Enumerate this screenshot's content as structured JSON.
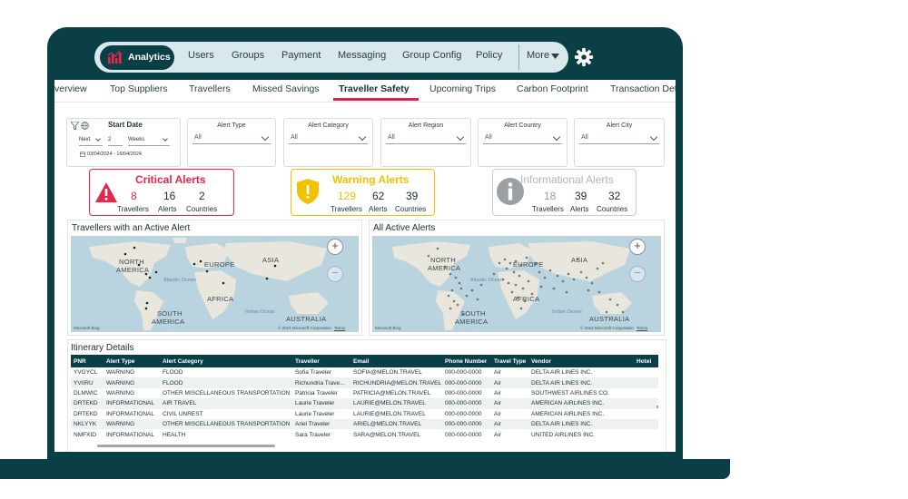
{
  "nav": {
    "analytics": "Analytics",
    "items": [
      "Users",
      "Groups",
      "Payment",
      "Messaging",
      "Group Config",
      "Policy"
    ],
    "more": "More"
  },
  "tabs": [
    "verview",
    "Top Suppliers",
    "Travellers",
    "Missed Savings",
    "Traveller Safety",
    "Upcoming Trips",
    "Carbon Footprint",
    "Transaction Deta"
  ],
  "active_tab": "Traveller Safety",
  "filters": {
    "start_date": {
      "label": "Start Date",
      "mode": "Next",
      "count": "2",
      "unit": "Weeks",
      "range": "03/04/2024 - 16/04/2024"
    },
    "dropdowns": [
      {
        "label": "Alert Type",
        "value": "All"
      },
      {
        "label": "Alert Category",
        "value": "All"
      },
      {
        "label": "Alert Region",
        "value": "All"
      },
      {
        "label": "Alert Country",
        "value": "All"
      },
      {
        "label": "Alert City",
        "value": "All"
      }
    ]
  },
  "kpis": [
    {
      "title": "Critical Alerts",
      "travellers": "8",
      "alerts": "16",
      "countries": "2",
      "color": "#e6274b",
      "icon": "warning-triangle-icon"
    },
    {
      "title": "Warning Alerts",
      "travellers": "129",
      "alerts": "62",
      "countries": "39",
      "color": "#f2c200",
      "icon": "shield-exclamation-icon"
    },
    {
      "title": "Informational Alerts",
      "travellers": "18",
      "alerts": "39",
      "countries": "32",
      "color": "#9aa0a3",
      "icon": "info-circle-icon"
    }
  ],
  "kpi_labels": {
    "travellers": "Travellers",
    "alerts": "Alerts",
    "countries": "Countries"
  },
  "maps": {
    "left_title": "Travellers with an Active Alert",
    "right_title": "All Active Alerts",
    "labels": {
      "north": "NORTH",
      "america": "AMERICA",
      "europe": "EUROPE",
      "asia": "ASIA",
      "africa": "AFRICA",
      "south": "SOUTH",
      "australia": "AUSTRALIA",
      "atlantic": "Atlantic Ocean",
      "indian": "Indian Ocean"
    },
    "ms_bing": "Microsoft Bing",
    "copyright": "© 2024 Microsoft Corporation",
    "terms": "Terms",
    "zoom_in": "+",
    "zoom_out": "−"
  },
  "itinerary": {
    "title": "Itinerary Details",
    "columns": [
      "PNR",
      "Alert Type",
      "Alert Category",
      "Traveller",
      "Email",
      "Phone Number",
      "Travel Type",
      "Vendor",
      "Hotel"
    ],
    "rows": [
      [
        "YVGYCL",
        "WARNING",
        "FLOOD",
        "Sofia Traveler",
        "SOFIA@MELON.TRAVEL",
        "000-000-0000",
        "Air",
        "DELTA AIR LINES INC.",
        ""
      ],
      [
        "YVIIRU",
        "WARNING",
        "FLOOD",
        "Richundria Trave...",
        "RICHUNDRIA@MELON.TRAVEL",
        "000-000-0000",
        "Air",
        "DELTA AIR LINES INC.",
        ""
      ],
      [
        "DLMWIC",
        "WARNING",
        "OTHER MISCELLANEOUS TRANSPORTATION",
        "Patricia Traveler",
        "PATRICIA@MELON.TRAVEL",
        "000-000-0000",
        "Air",
        "SOUTHWEST AIRLINES CO.",
        ""
      ],
      [
        "DRTEKD",
        "INFORMATIONAL",
        "AIR TRAVEL",
        "Laurie Traveler",
        "LAURIE@MELON.TRAVEL",
        "000-000-0000",
        "Air",
        "AMERICAN AIRLINES INC.",
        ""
      ],
      [
        "DRTEKD",
        "INFORMATIONAL",
        "CIVIL UNREST",
        "Laurie Traveler",
        "LAURIE@MELON.TRAVEL",
        "000-000-0000",
        "Air",
        "AMERICAN AIRLINES INC.",
        ""
      ],
      [
        "NKLYYK",
        "WARNING",
        "OTHER MISCELLANEOUS TRANSPORTATION",
        "Ariel Traveler",
        "ARIEL@MELON.TRAVEL",
        "000-000-0000",
        "Air",
        "DELTA AIR LINES INC.",
        ""
      ],
      [
        "NMFXID",
        "INFORMATIONAL",
        "HEALTH",
        "Sara Traveler",
        "SARA@MELON.TRAVEL",
        "000-000-0000",
        "Air",
        "UNITED AIRLINES INC.",
        ""
      ]
    ]
  },
  "colors": {
    "brand_dark": "#0b3f46",
    "accent": "#d7264d",
    "warning": "#f2c200",
    "critical": "#e6274b",
    "info": "#9aa0a3"
  }
}
